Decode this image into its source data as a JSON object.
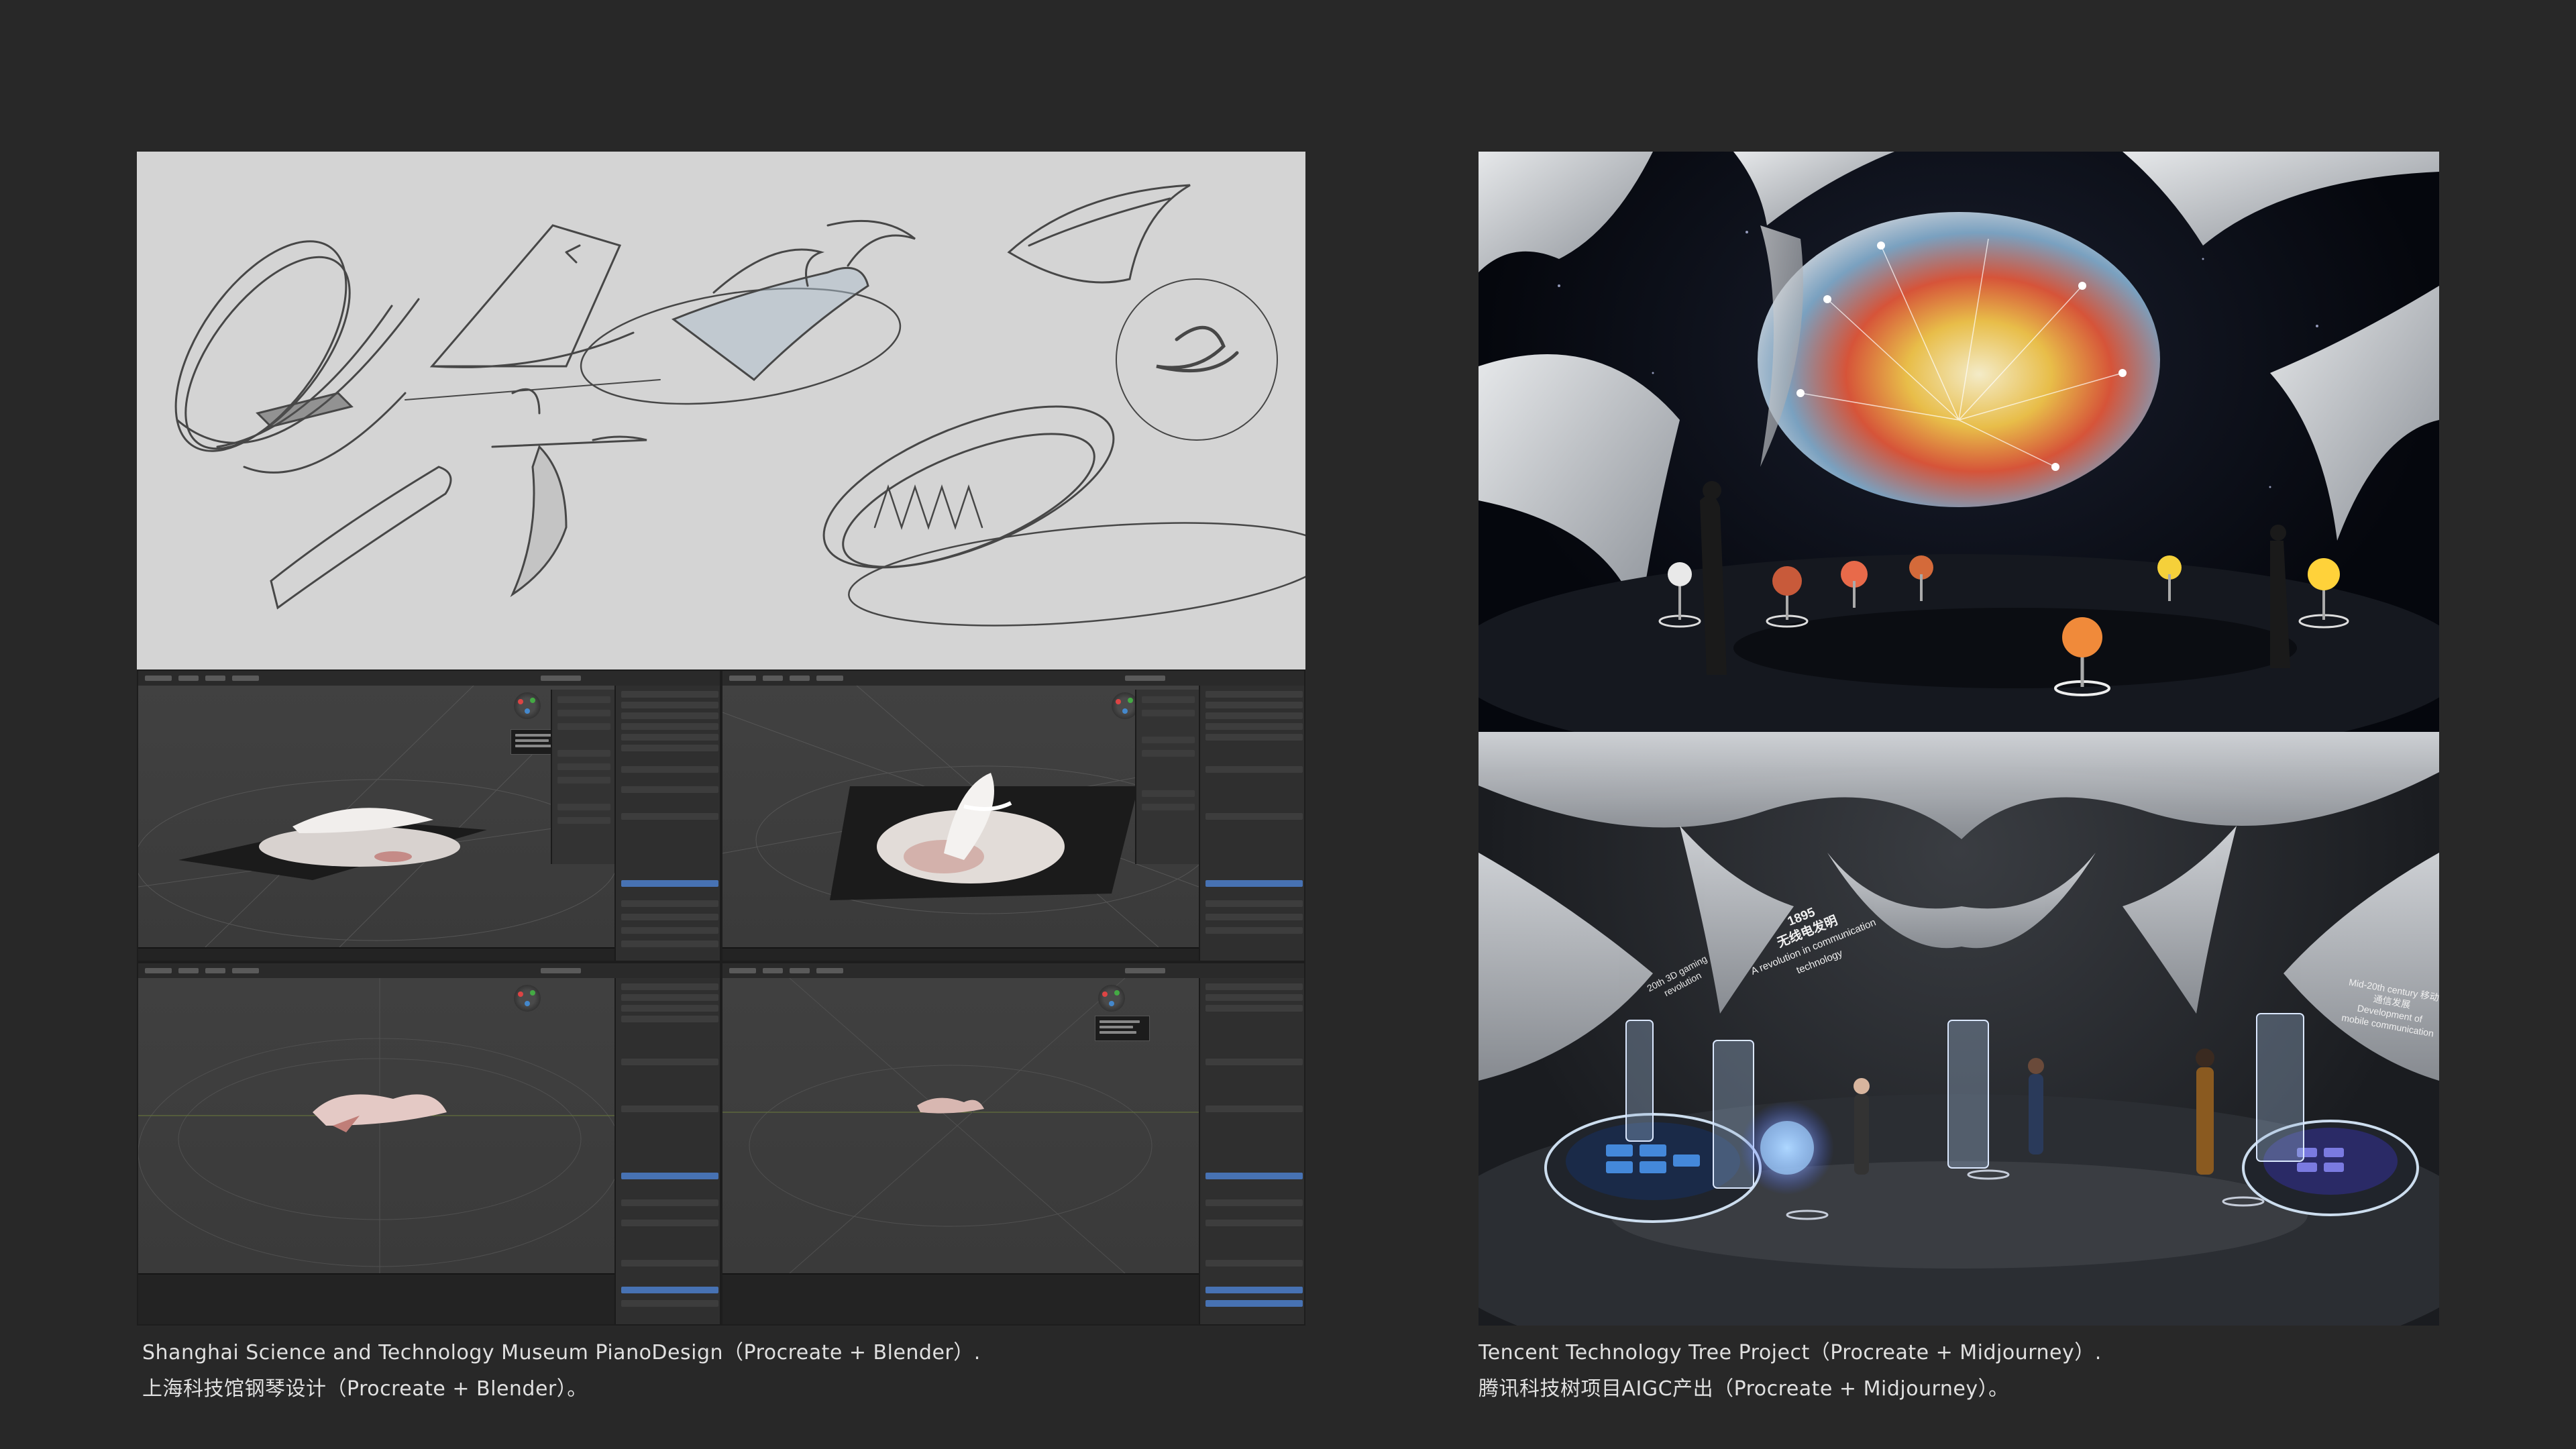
{
  "left_project": {
    "caption_en": "Shanghai Science and Technology Museum PianoDesign（Procreate + Blender）.",
    "caption_zh": "上海科技馆钢琴设计（Procreate + Blender）。"
  },
  "right_project": {
    "caption_en": "Tencent Technology Tree Project（Procreate + Midjourney）.",
    "caption_zh": "腾讯科技树项目AIGC产出（Procreate + Midjourney）。",
    "banners": {
      "banner_1_year": "1895",
      "banner_1_zh": "无线电发明",
      "banner_1_en": "A revolution in communication technology",
      "banner_2_text": "20th 3D gaming revolution",
      "banner_3_text": "Mid-20th century 移动通信发展 Development of mobile communication"
    }
  },
  "colors": {
    "background": "#282828",
    "sketch_paper": "#d4d4d4",
    "blender_bg": "#3b3b3b",
    "blender_accent": "#4772b3",
    "caption_text": "#e0e0e0"
  },
  "icons": [
    "blender-navigation-gizmo-icon"
  ]
}
